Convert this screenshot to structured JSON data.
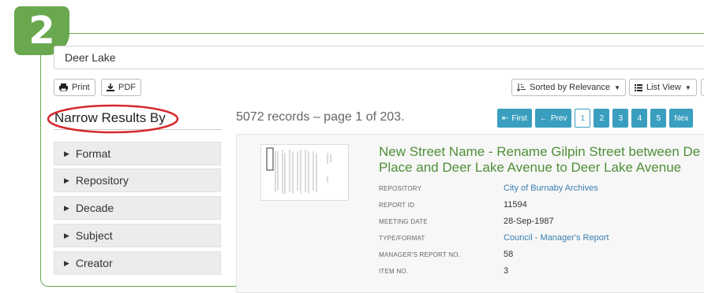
{
  "step_number": "2",
  "search": {
    "value": "Deer Lake"
  },
  "toolbar": {
    "print_label": "Print",
    "pdf_label": "PDF",
    "sort_label": "Sorted by Relevance",
    "view_label": "List View"
  },
  "sidebar": {
    "title": "Narrow Results By",
    "facets": [
      "Format",
      "Repository",
      "Decade",
      "Subject",
      "Creator"
    ]
  },
  "results": {
    "count_text": "5072 records – page 1 of 203.",
    "pagination": {
      "first": "First",
      "prev": "Prev",
      "pages": [
        "1",
        "2",
        "3",
        "4",
        "5"
      ],
      "current": "1",
      "next": "Nex"
    },
    "item": {
      "title": "New Street Name - Rename Gilpin Street between De Place and Deer Lake Avenue to Deer Lake Avenue",
      "meta": [
        {
          "label": "REPOSITORY",
          "value": "City of Burnaby Archives",
          "link": true
        },
        {
          "label": "REPORT ID",
          "value": "11594",
          "link": false
        },
        {
          "label": "MEETING DATE",
          "value": "28-Sep-1987",
          "link": false
        },
        {
          "label": "TYPE/FORMAT",
          "value": "Council - Manager's Report",
          "link": true
        },
        {
          "label": "MANAGER'S REPORT NO.",
          "value": "58",
          "link": false
        },
        {
          "label": "ITEM NO.",
          "value": "3",
          "link": false
        }
      ]
    }
  },
  "colors": {
    "brand_green": "#6aa84f",
    "highlight_red": "#d6282a",
    "pager_blue": "#3a9fbf",
    "link_blue": "#3b7fb0"
  }
}
